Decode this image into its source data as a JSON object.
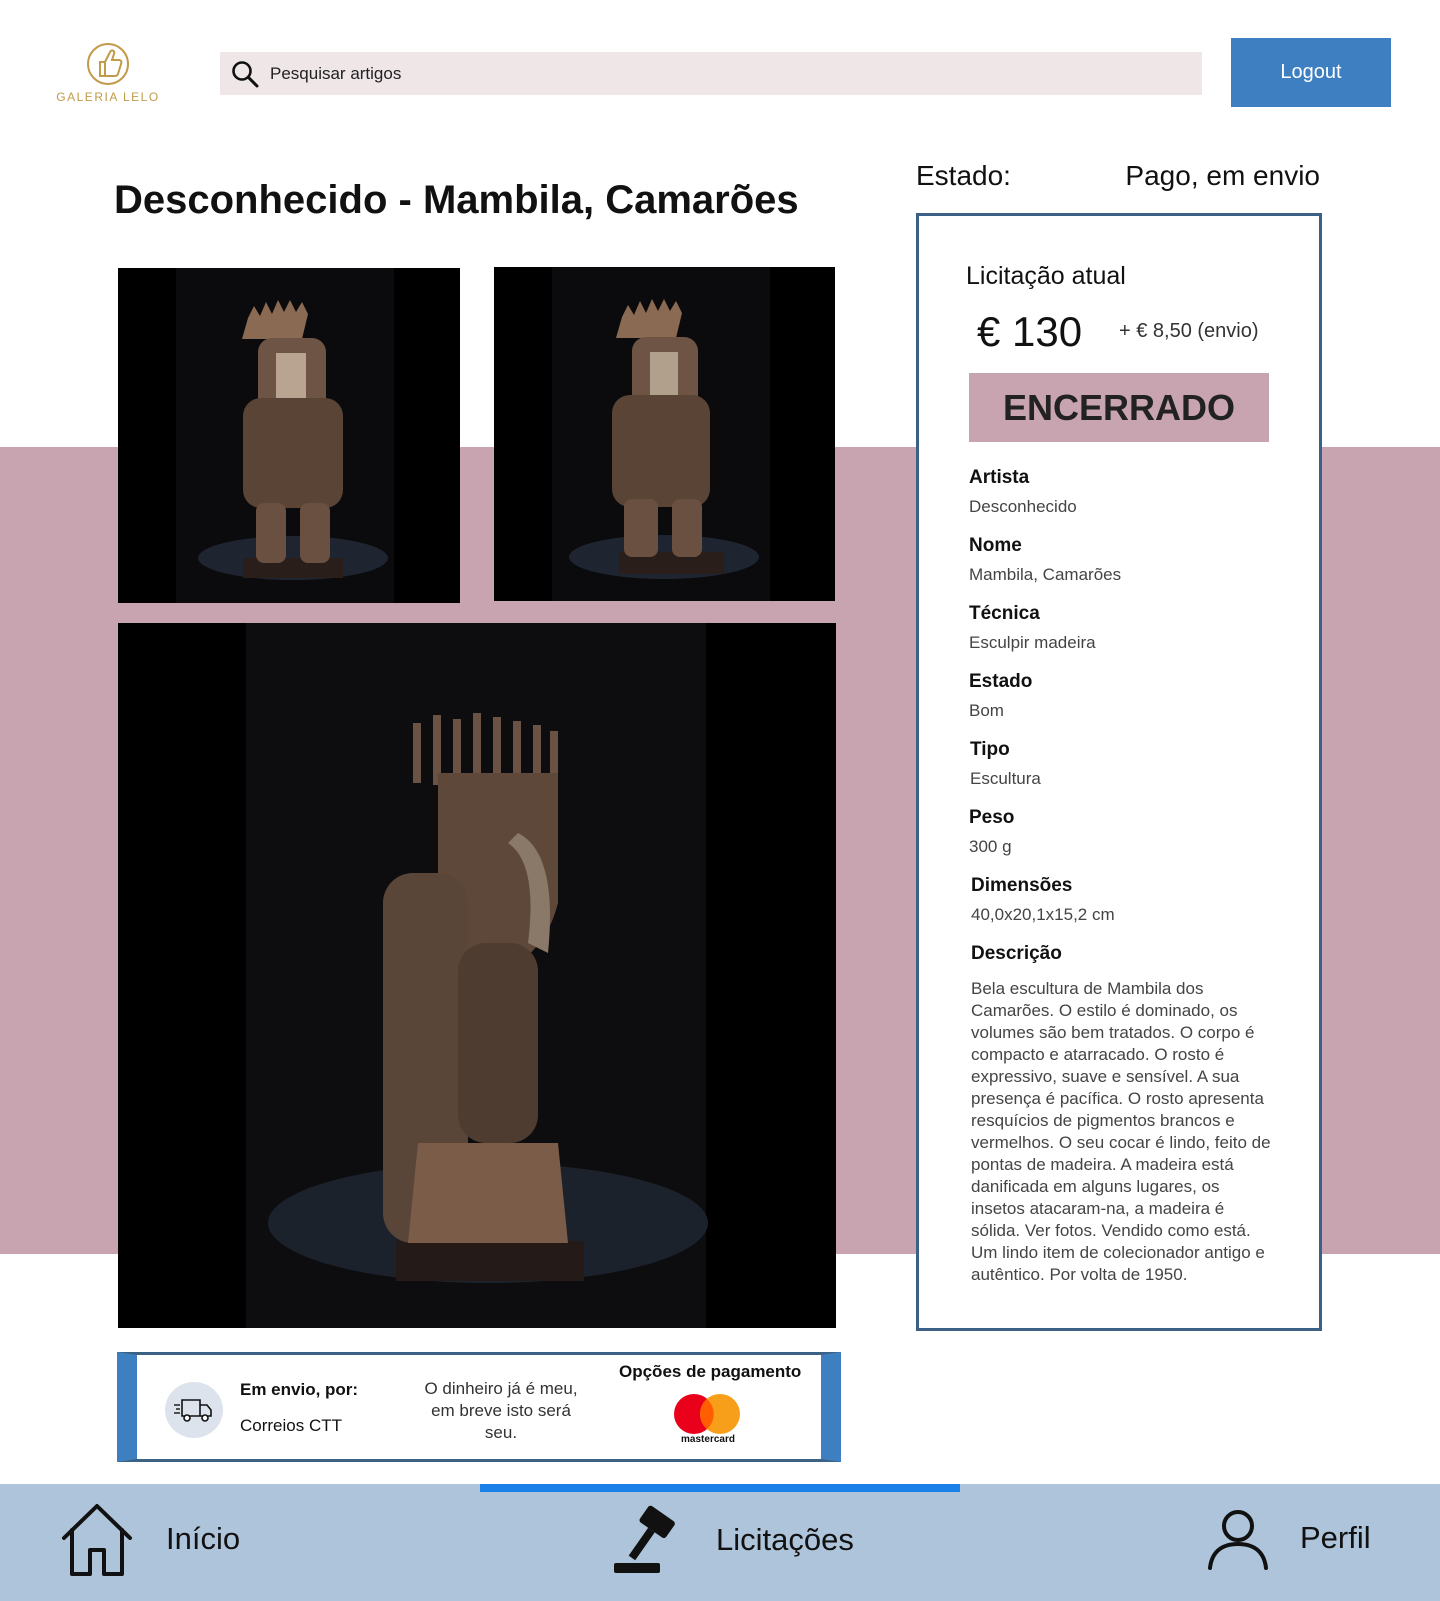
{
  "header": {
    "logo_text": "GALERIA LELO",
    "search_placeholder": "Pesquisar artigos",
    "logout_label": "Logout"
  },
  "item": {
    "title": "Desconhecido - Mambila, Camarões",
    "status_label": "Estado:",
    "status_value": "Pago, em envio"
  },
  "bid": {
    "label": "Licitação atual",
    "price": "€ 130",
    "shipping": "+ € 8,50 (envio)",
    "badge": "ENCERRADO"
  },
  "specs": [
    {
      "label": "Artista",
      "value": "Desconhecido"
    },
    {
      "label": "Nome",
      "value": "Mambila, Camarões"
    },
    {
      "label": "Técnica",
      "value": "Esculpir madeira"
    },
    {
      "label": "Estado",
      "value": "Bom"
    },
    {
      "label": "Tipo",
      "value": "Escultura"
    },
    {
      "label": "Peso",
      "value": "300 g"
    },
    {
      "label": "Dimensões",
      "value": "40,0x20,1x15,2 cm"
    },
    {
      "label": "Descrição",
      "value": ""
    }
  ],
  "description": "Bela escultura de Mambila dos Camarões. O estilo é dominado, os volumes são bem tratados. O corpo é compacto e atarracado. O rosto é expressivo, suave e sensível. A sua presença é pacífica. O rosto apresenta resquícios de pigmentos brancos e vermelhos. O seu cocar é lindo, feito de pontas de madeira. A madeira está danificada em alguns lugares, os insetos atacaram-na, a madeira é sólida. Ver fotos. Vendido como está. Um lindo item de colecionador antigo e autêntico. Por volta de 1950.",
  "shipping": {
    "title": "Em envio, por:",
    "carrier": "Correios CTT",
    "message": "O dinheiro já é meu, em breve isto será seu.",
    "payment_title": "Opções de pagamento",
    "payment_brand": "mastercard"
  },
  "nav": {
    "home": "Início",
    "bids": "Licitações",
    "profile": "Perfil"
  },
  "colors": {
    "accent": "#3e7fc1",
    "band": "#c8a3b0",
    "nav": "#aec4da",
    "active_indicator": "#1a7fe6"
  }
}
